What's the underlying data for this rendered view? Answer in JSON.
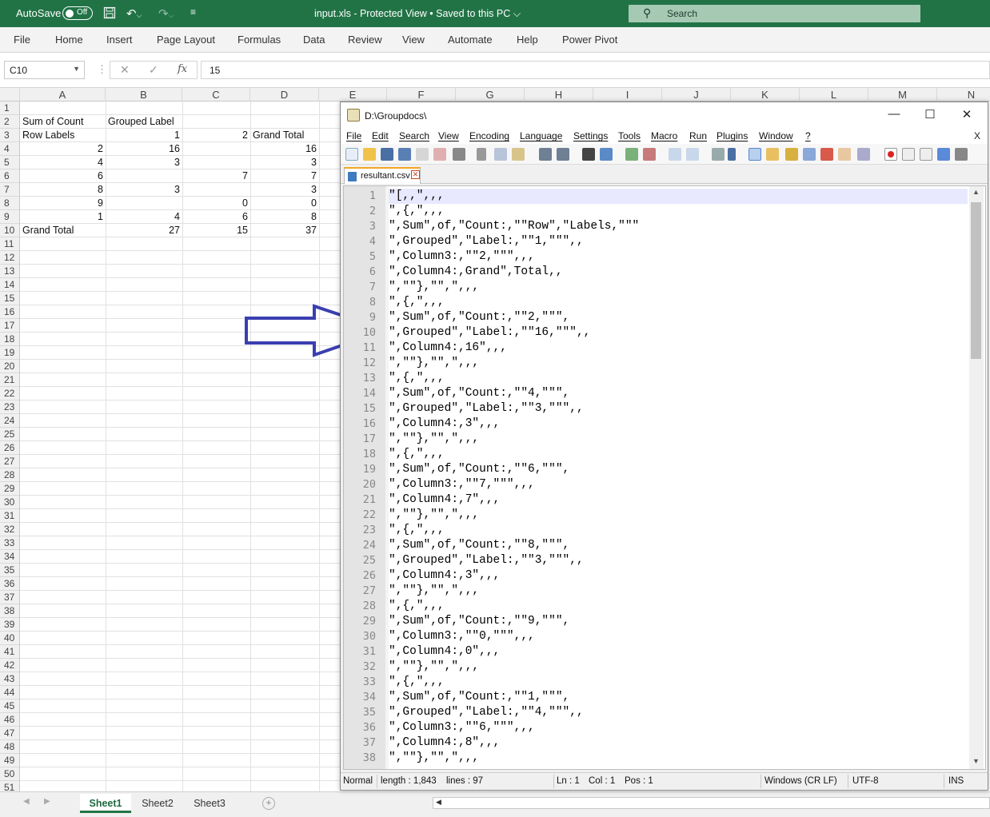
{
  "excel": {
    "titlebar": {
      "autosave_label": "AutoSave",
      "autosave_state": "Off",
      "doc_title": "input.xls  -  Protected View  •  Saved to this PC ⌵",
      "search_placeholder": "Search"
    },
    "ribbon_tabs": [
      "File",
      "Home",
      "Insert",
      "Page Layout",
      "Formulas",
      "Data",
      "Review",
      "View",
      "Automate",
      "Help",
      "Power Pivot"
    ],
    "formula_bar": {
      "name_box": "C10",
      "value": "15",
      "fx": "fx"
    },
    "columns": [
      "A",
      "B",
      "C",
      "D",
      "E",
      "F",
      "G",
      "H",
      "I",
      "J",
      "K",
      "L",
      "M",
      "N"
    ],
    "rows": [
      "1",
      "2",
      "3",
      "4",
      "5",
      "6",
      "7",
      "8",
      "9",
      "10",
      "11",
      "12",
      "13",
      "14",
      "15",
      "16",
      "17",
      "18",
      "19",
      "20",
      "21",
      "22",
      "23",
      "24",
      "25",
      "26",
      "27",
      "28",
      "29",
      "30",
      "31",
      "32",
      "33",
      "34",
      "35",
      "36",
      "37",
      "38",
      "39",
      "40",
      "41",
      "42",
      "43",
      "44",
      "45",
      "46",
      "47",
      "48",
      "49",
      "50",
      "51"
    ],
    "cells": {
      "A2": "Sum of Count",
      "B2": "Grouped Label",
      "A3": "Row Labels",
      "B3": "1",
      "C3": "2",
      "D3": "Grand Total",
      "A4": "2",
      "B4": "16",
      "D4": "16",
      "A5": "4",
      "B5": "3",
      "D5": "3",
      "A6": "6",
      "C6": "7",
      "D6": "7",
      "A7": "8",
      "B7": "3",
      "D7": "3",
      "A8": "9",
      "C8": "0",
      "D8": "0",
      "A9": "1",
      "B9": "4",
      "C9": "6",
      "D9": "8",
      "A10": "Grand Total",
      "B10": "27",
      "C10": "15",
      "D10": "37"
    },
    "sheets": [
      "Sheet1",
      "Sheet2",
      "Sheet3"
    ],
    "active_sheet": "Sheet1"
  },
  "notepad": {
    "title": "D:\\Groupdocs\\",
    "menu": [
      "File",
      "Edit",
      "Search",
      "View",
      "Encoding",
      "Language",
      "Settings",
      "Tools",
      "Macro",
      "Run",
      "Plugins",
      "Window",
      "?"
    ],
    "close_doc": "X",
    "tab": "resultant.csv",
    "lines": [
      "\"[,,\",,,",
      "\",{,\",,,",
      "\",Sum\",of,\"Count:,\"\"Row\",\"Labels,\"\"\"",
      "\",Grouped\",\"Label:,\"\"1,\"\"\",,",
      "\",Column3:,\"\"2,\"\"\",,,",
      "\",Column4:,Grand\",Total,,",
      "\",\"\"},\"\",\",,,",
      "\",{,\",,,",
      "\",Sum\",of,\"Count:,\"\"2,\"\"\",",
      "\",Grouped\",\"Label:,\"\"16,\"\"\",,",
      "\",Column4:,16\",,,",
      "\",\"\"},\"\",\",,,",
      "\",{,\",,,",
      "\",Sum\",of,\"Count:,\"\"4,\"\"\",",
      "\",Grouped\",\"Label:,\"\"3,\"\"\",,",
      "\",Column4:,3\",,,",
      "\",\"\"},\"\",\",,,",
      "\",{,\",,,",
      "\",Sum\",of,\"Count:,\"\"6,\"\"\",",
      "\",Column3:,\"\"7,\"\"\",,,",
      "\",Column4:,7\",,,",
      "\",\"\"},\"\",\",,,",
      "\",{,\",,,",
      "\",Sum\",of,\"Count:,\"\"8,\"\"\",",
      "\",Grouped\",\"Label:,\"\"3,\"\"\",,",
      "\",Column4:,3\",,,",
      "\",\"\"},\"\",\",,,",
      "\",{,\",,,",
      "\",Sum\",of,\"Count:,\"\"9,\"\"\",",
      "\",Column3:,\"\"0,\"\"\",,,",
      "\",Column4:,0\",,,",
      "\",\"\"},\"\",\",,,",
      "\",{,\",,,",
      "\",Sum\",of,\"Count:,\"\"1,\"\"\",",
      "\",Grouped\",\"Label:,\"\"4,\"\"\",,",
      "\",Column3:,\"\"6,\"\"\",,,",
      "\",Column4:,8\",,,",
      "\",\"\"},\"\",\",,,"
    ],
    "status": {
      "mode": "Normal",
      "length": "length : 1,843",
      "lines": "lines : 97",
      "ln": "Ln : 1",
      "col": "Col : 1",
      "pos": "Pos : 1",
      "eol": "Windows (CR LF)",
      "encoding": "UTF-8",
      "ins": "INS"
    }
  },
  "colors": {
    "excel_green": "#217346",
    "arrow": "#3a3fb0",
    "current_line": "#e8e8ff"
  },
  "icons": [
    "save-icon",
    "undo-icon",
    "redo-icon",
    "search-icon",
    "notepad-icon",
    "minimize-icon",
    "maximize-icon",
    "close-icon",
    "arrow-icon"
  ]
}
